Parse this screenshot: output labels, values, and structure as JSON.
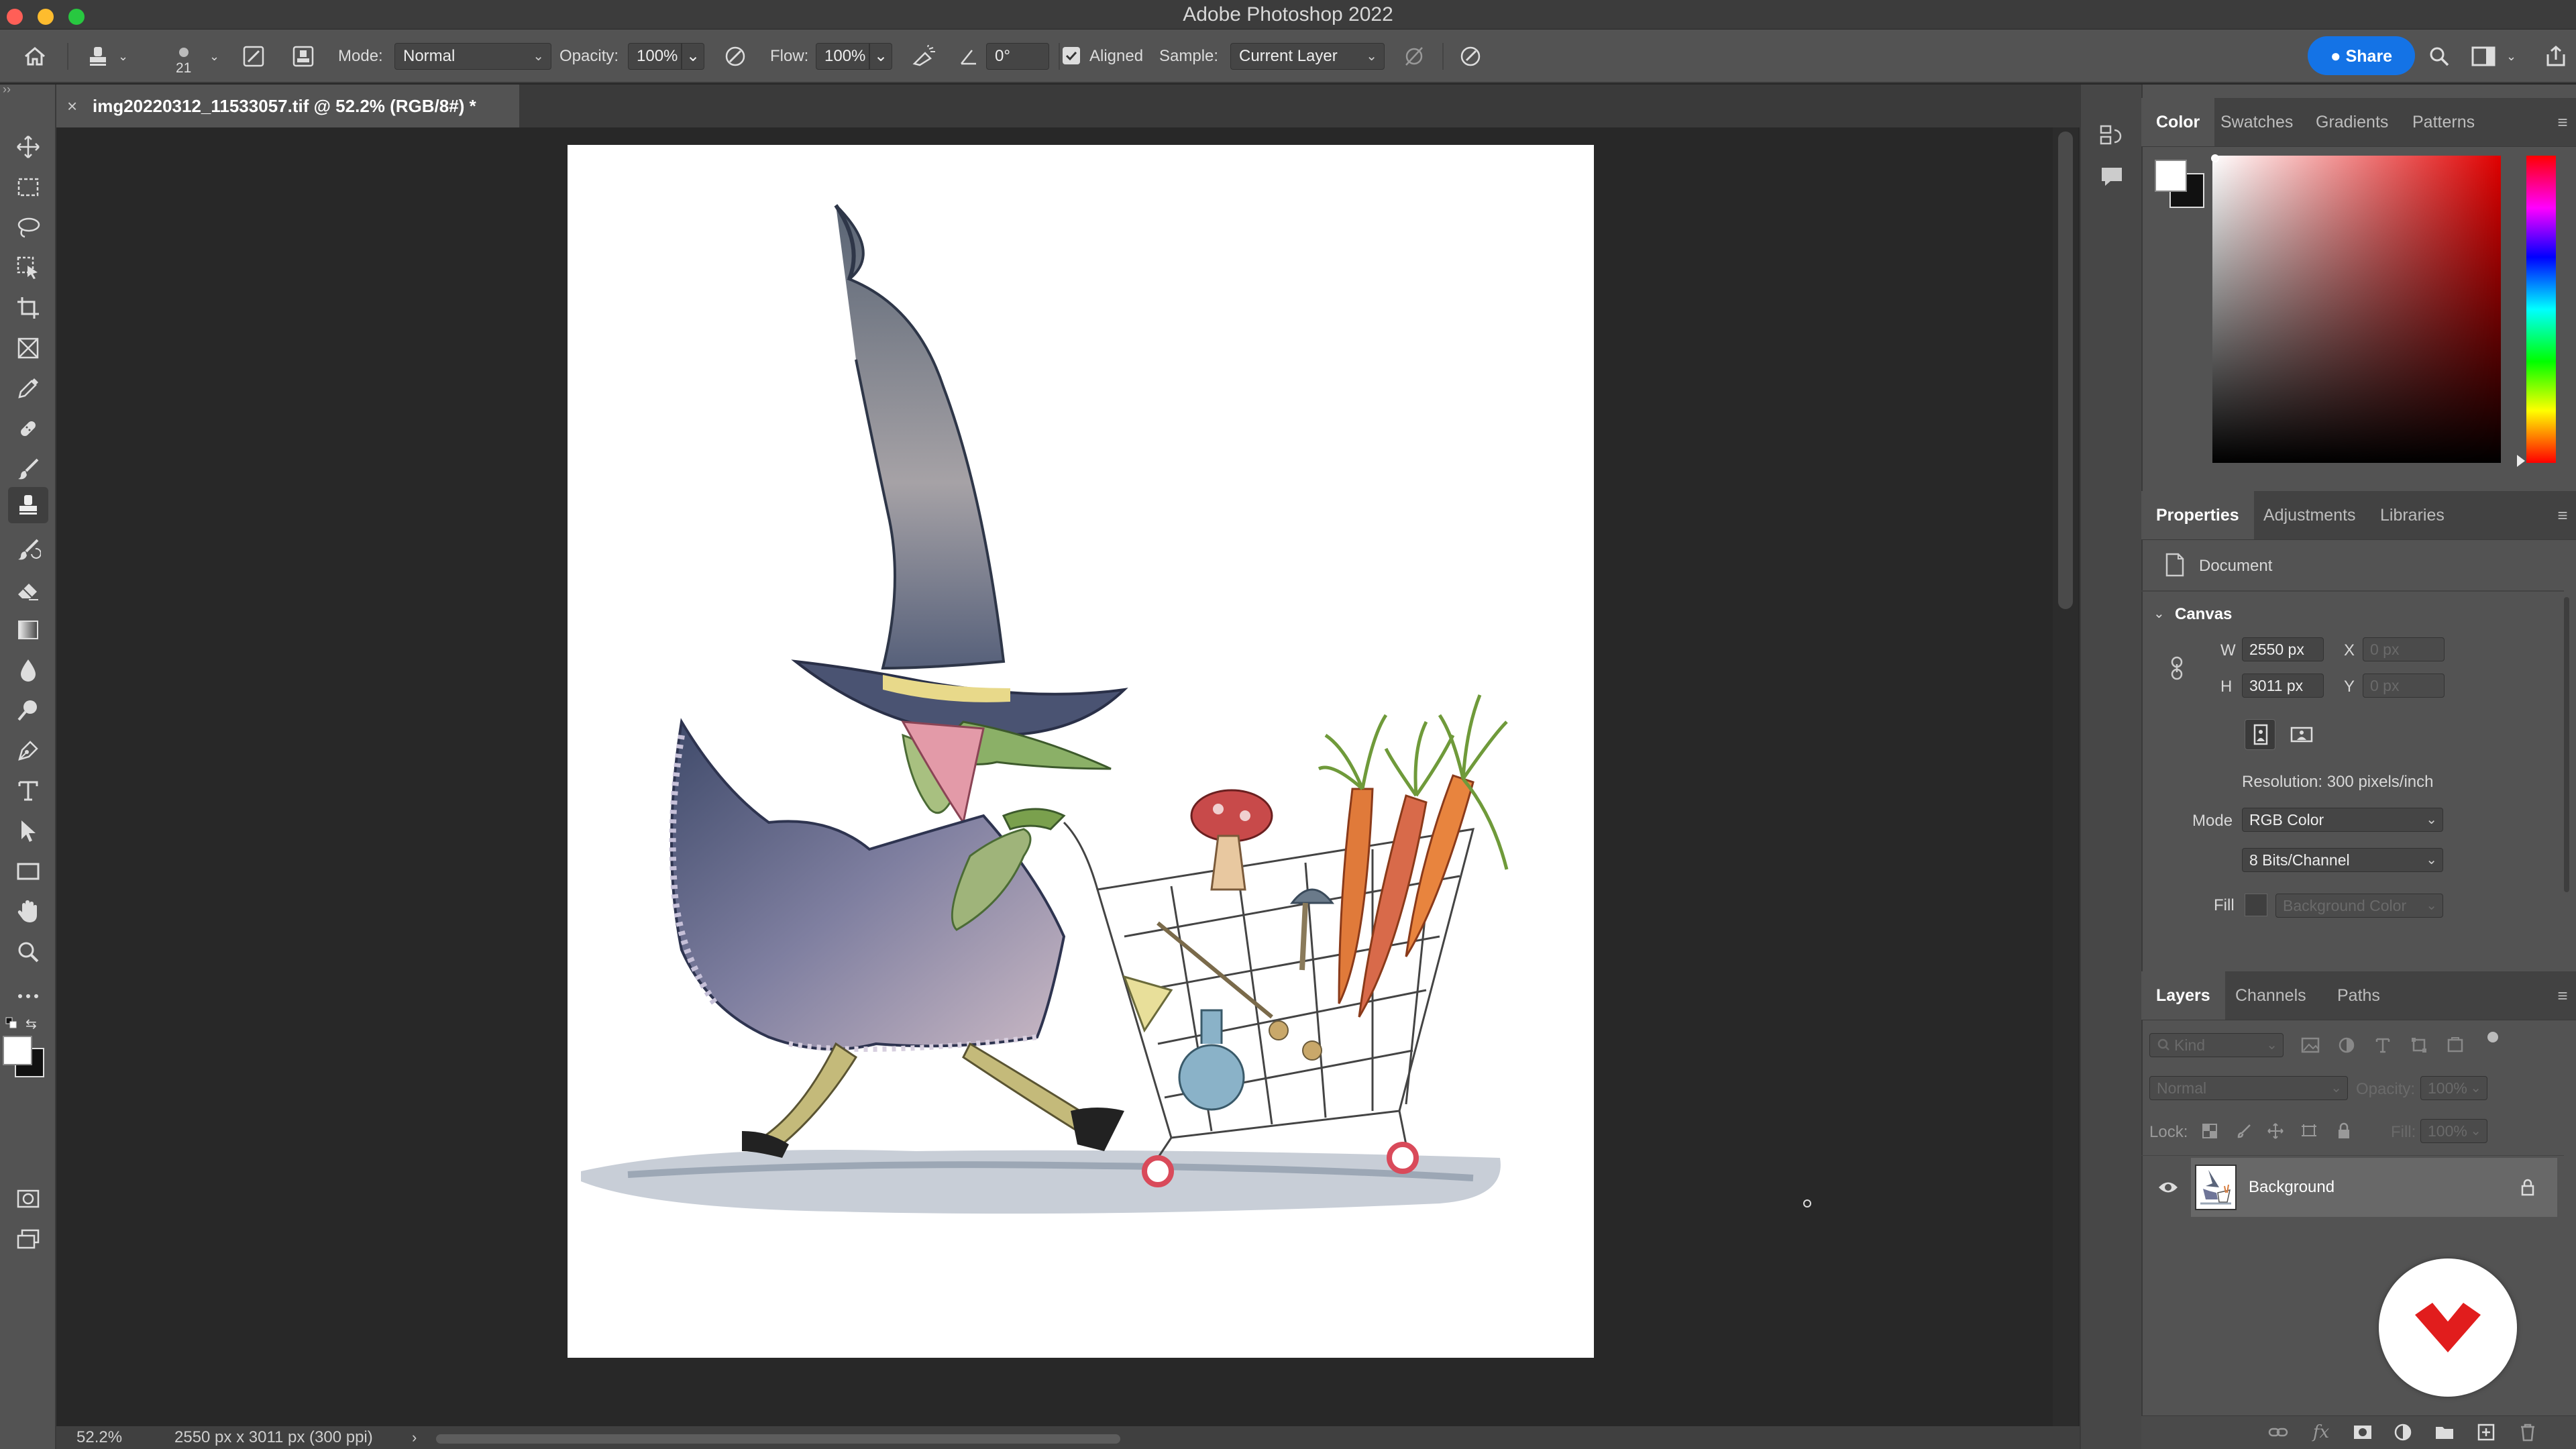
{
  "window": {
    "title": "Adobe Photoshop 2022"
  },
  "options_bar": {
    "brush_size": "21",
    "mode_label": "Mode:",
    "mode_value": "Normal",
    "opacity_label": "Opacity:",
    "opacity_value": "100%",
    "flow_label": "Flow:",
    "flow_value": "100%",
    "angle_value": "0°",
    "aligned_label": "Aligned",
    "sample_label": "Sample:",
    "sample_value": "Current Layer",
    "share_label": "Share"
  },
  "document": {
    "tab_title": "img20220312_11533057.tif @ 52.2% (RGB/8#) *",
    "close_glyph": "×"
  },
  "status_bar": {
    "zoom": "52.2%",
    "doc_info": "2550 px x 3011 px (300 ppi)"
  },
  "color_panel": {
    "tabs": [
      "Color",
      "Swatches",
      "Gradients",
      "Patterns"
    ],
    "active_tab": 0
  },
  "properties_panel": {
    "tabs": [
      "Properties",
      "Adjustments",
      "Libraries"
    ],
    "active_tab": 0,
    "type_label": "Document",
    "section_label": "Canvas",
    "w_label": "W",
    "w_value": "2550 px",
    "h_label": "H",
    "h_value": "3011 px",
    "x_label": "X",
    "x_value": "0 px",
    "y_label": "Y",
    "y_value": "0 px",
    "resolution": "Resolution: 300 pixels/inch",
    "mode_label": "Mode",
    "mode_value": "RGB Color",
    "bits_value": "8 Bits/Channel",
    "fill_label": "Fill",
    "fill_value": "Background Color"
  },
  "layers_panel": {
    "tabs": [
      "Layers",
      "Channels",
      "Paths"
    ],
    "active_tab": 0,
    "filter_placeholder": "Kind",
    "blend_mode": "Normal",
    "opacity_label": "Opacity:",
    "opacity_value": "100%",
    "lock_label": "Lock:",
    "fill_label": "Fill:",
    "fill_value": "100%",
    "layers": [
      {
        "name": "Background",
        "visible": true,
        "locked": true
      }
    ]
  },
  "colors": {
    "accent": "#1473e6",
    "panel_bg": "#535353",
    "canvas_bg": "#282828",
    "brand_badge": "#e11d1d"
  }
}
